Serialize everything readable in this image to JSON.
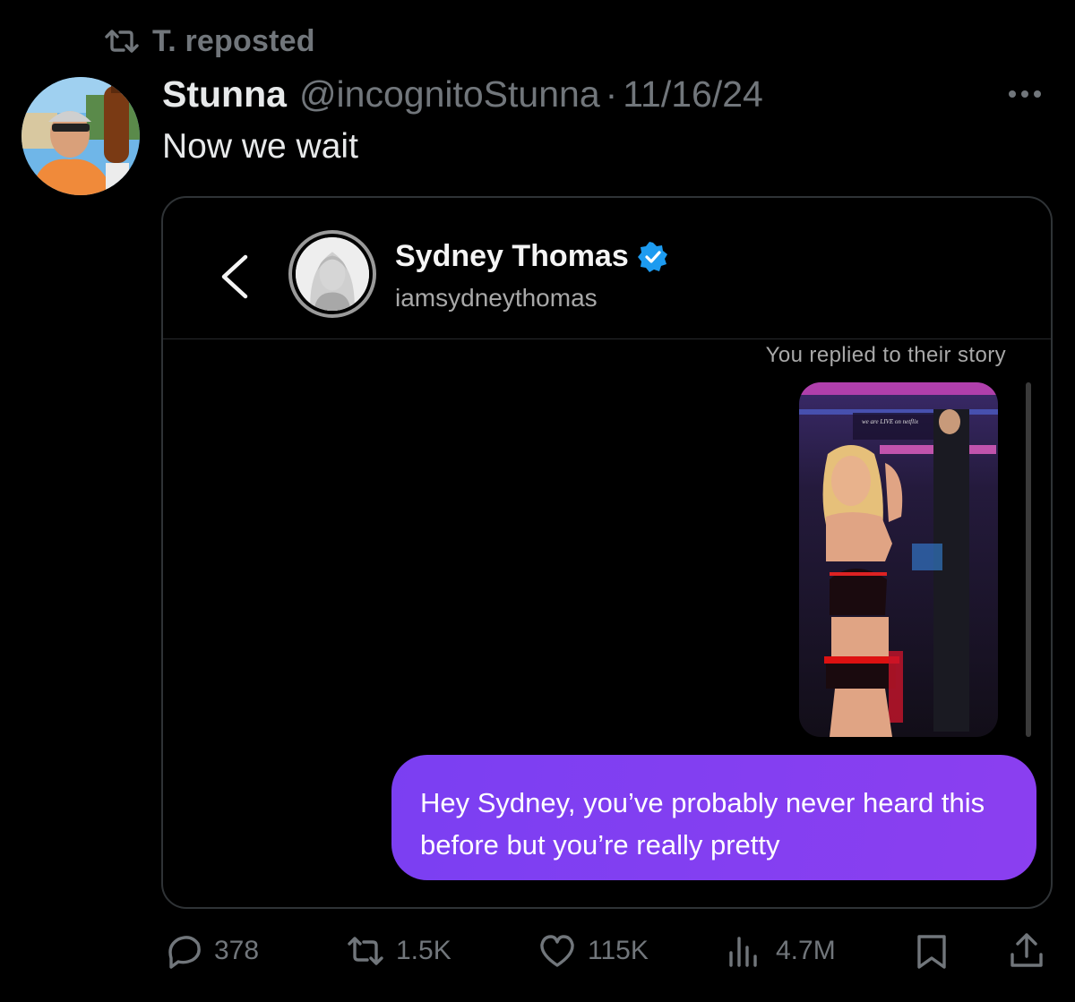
{
  "repost": {
    "label": "T. reposted",
    "icon": "repost-icon"
  },
  "tweet": {
    "display_name": "Stunna",
    "handle": "@incognitoStunna",
    "separator": "·",
    "date": "11/16/24",
    "text": "Now we wait"
  },
  "embed": {
    "dm_name": "Sydney Thomas",
    "dm_username": "iamsydneythomas",
    "replied_note": "You replied to their story",
    "message": "Hey Sydney, you’ve probably never heard this before but you’re really pretty"
  },
  "actions": {
    "replies": "378",
    "reposts": "1.5K",
    "likes": "115K",
    "views": "4.7M"
  },
  "colors": {
    "background": "#000000",
    "muted": "#71767b",
    "bubble": "#7b3ff2",
    "verified": "#1d9bf0"
  }
}
